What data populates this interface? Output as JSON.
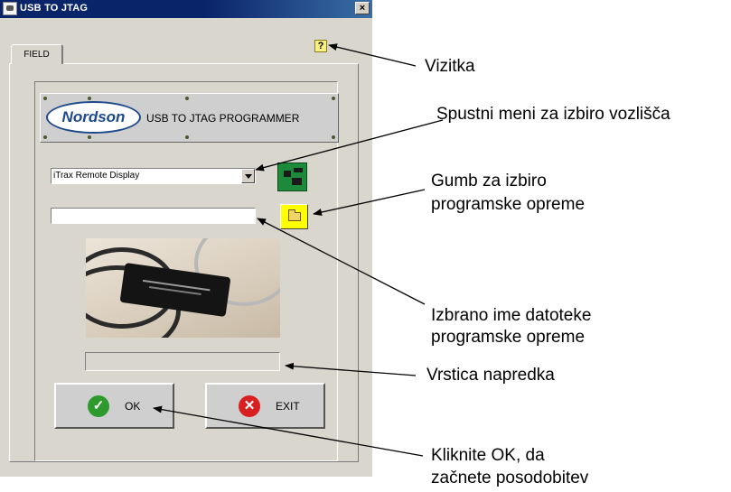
{
  "window": {
    "title": "USB TO JTAG",
    "close_glyph": "×"
  },
  "tabs": [
    {
      "label": "FIELD"
    }
  ],
  "help_icon": {
    "glyph": "?"
  },
  "banner": {
    "logo_text": "Nordson",
    "title": "USB TO JTAG PROGRAMMER"
  },
  "node_select": {
    "value": "iTrax Remote Display"
  },
  "file_input": {
    "value": ""
  },
  "progress": {
    "value": 0
  },
  "buttons": {
    "ok_label": "OK",
    "exit_label": "EXIT"
  },
  "icons": {
    "ok_icon": "check-icon",
    "exit_icon": "x-icon",
    "folder_icon": "folder-open-icon",
    "node_icon": "circuit-board-icon",
    "help_icon": "help-icon"
  },
  "callouts": {
    "vizitka": "Vizitka",
    "dropdown": "Spustni meni za izbiro vozlišča",
    "browse_line1": "Gumb za izbiro",
    "browse_line2": "programske opreme",
    "filename_line1": "Izbrano ime datoteke",
    "filename_line2": "programske opreme",
    "progress": "Vrstica napredka",
    "ok_line1": "Kliknite OK, da",
    "ok_line2": "začnete posodobitev"
  },
  "colors": {
    "titlebar": "#0a246a",
    "folder_button": "#ffff00",
    "ok_green": "#2e9a2e",
    "exit_red": "#d92020",
    "logo_blue": "#1e4a8c"
  }
}
